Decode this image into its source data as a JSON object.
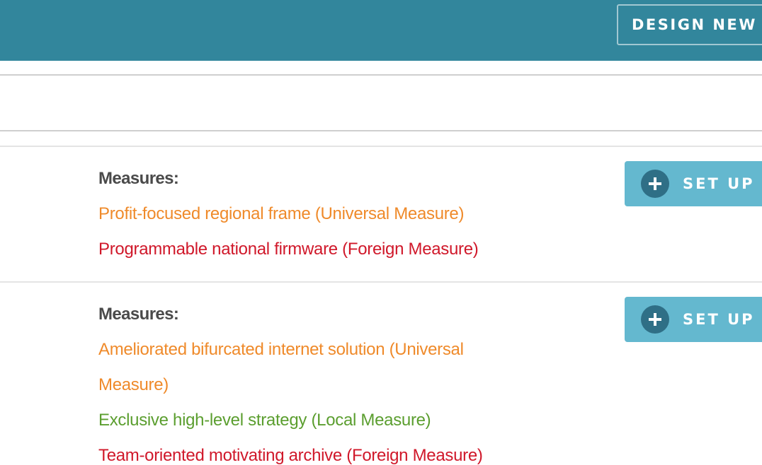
{
  "header": {
    "design_button_label": "DESIGN NEW E"
  },
  "measure_groups": [
    {
      "heading": "Measures:",
      "items": [
        {
          "text": "Profit-focused regional frame (Universal Measure)",
          "type": "universal"
        },
        {
          "text": "Programmable national firmware (Foreign Measure)",
          "type": "foreign"
        }
      ],
      "setup_button_label": "SET UP I"
    },
    {
      "heading": "Measures:",
      "items": [
        {
          "text": "Ameliorated bifurcated internet solution (Universal Measure)",
          "type": "universal"
        },
        {
          "text": "Exclusive high-level strategy (Local Measure)",
          "type": "local"
        },
        {
          "text": "Team-oriented motivating archive (Foreign Measure)",
          "type": "foreign"
        }
      ],
      "setup_button_label": "SET UP I"
    }
  ],
  "colors": {
    "header_bg": "#32869c",
    "universal": "#ef8a2a",
    "local": "#5b9e2f",
    "foreign": "#d0182a",
    "setup_button_bg": "#64b8cf",
    "plus_circle": "#2f6f86"
  }
}
